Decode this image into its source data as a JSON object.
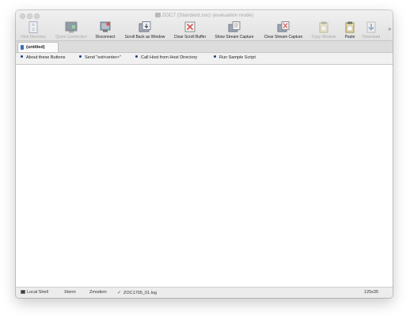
{
  "window": {
    "title": "ZOC7 (Standard.zoc) (evaluation mode)"
  },
  "toolbar": {
    "items": [
      {
        "label": "Host Directory",
        "icon": "host-directory-icon",
        "enabled": false
      },
      {
        "label": "Quick Connection",
        "icon": "quick-connection-icon",
        "enabled": false
      },
      {
        "label": "Disconnect",
        "icon": "disconnect-icon",
        "enabled": true
      },
      {
        "label": "Scroll Back as Window",
        "icon": "scroll-back-icon",
        "enabled": true
      },
      {
        "label": "Clear Scroll Buffer",
        "icon": "clear-buffer-icon",
        "enabled": true
      },
      {
        "label": "Show Stream Capture",
        "icon": "show-capture-icon",
        "enabled": true
      },
      {
        "label": "Clear Stream Capture",
        "icon": "clear-capture-icon",
        "enabled": true
      },
      {
        "label": "Copy Window",
        "icon": "copy-window-icon",
        "enabled": false
      },
      {
        "label": "Paste",
        "icon": "paste-icon",
        "enabled": true
      },
      {
        "label": "Download",
        "icon": "download-icon",
        "enabled": false
      }
    ],
    "overflow": "»"
  },
  "tabs": [
    {
      "label": "(untitled)",
      "active": true
    }
  ],
  "user_buttons": [
    {
      "label": "About these Buttons"
    },
    {
      "label": "Send \"exit<enter>\""
    },
    {
      "label": "Call Host from Host Directory"
    },
    {
      "label": "Run Sample Script"
    }
  ],
  "status": {
    "connection": "Local Shell",
    "emulation": "Xterm",
    "transfer": "Zmodem",
    "log_file": "ZOC1705_01.log",
    "size": "125x35"
  },
  "colors": {
    "accent": "#1d3a8a",
    "window_bg": "#ececec",
    "terminal_bg": "#ffffff"
  }
}
